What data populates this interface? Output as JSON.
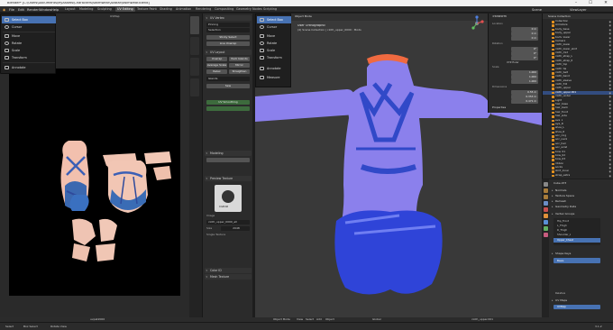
{
  "window": {
    "title": "Blender* [C:\\Users\\Documents\\MyAssets\\Characters\\swimwear\\Avatar\\swimwear.blend]"
  },
  "menubar": {
    "items": [
      "File",
      "Edit",
      "Render",
      "Window",
      "Help"
    ],
    "workspaces": [
      "Layout",
      "Modeling",
      "Sculpting",
      "UV Editing",
      "Texture Paint",
      "Shading",
      "Animation",
      "Rendering",
      "Compositing",
      "Geometry Nodes",
      "Scripting"
    ],
    "active_workspace": "UV Editing",
    "scene": "Scene",
    "view_layer": "ViewLayer"
  },
  "uv_tools": [
    {
      "label": "Select Box",
      "active": true
    },
    {
      "label": "Cursor",
      "active": false
    },
    {
      "label": "Move",
      "active": false
    },
    {
      "label": "Rotate",
      "active": false
    },
    {
      "label": "Scale",
      "active": false
    },
    {
      "label": "Transform",
      "active": false
    },
    {
      "label": "Annotate",
      "active": false
    }
  ],
  "viewport_tools": [
    {
      "label": "Select Box",
      "active": true
    },
    {
      "label": "Cursor",
      "active": false
    },
    {
      "label": "Move",
      "active": false
    },
    {
      "label": "Rotate",
      "active": false
    },
    {
      "label": "Scale",
      "active": false
    },
    {
      "label": "Transform",
      "active": false
    },
    {
      "label": "Annotate",
      "active": false
    },
    {
      "label": "Measure",
      "active": false
    }
  ],
  "uv_header": {
    "image_name": "uvpat2000",
    "uv_map": "UVMap"
  },
  "mid_panel": {
    "sections": [
      "UV Vertex",
      "UV Layout",
      "Modeling",
      "Preview Texture",
      "Color ID",
      "Mesh Texture"
    ],
    "buttons": [
      "Sticky Select",
      "Live Unwrap",
      "Unwrap",
      "Pack Islands",
      "Average Scale",
      "Mirror",
      "Relax",
      "Straighten",
      "Sew",
      "UV Smoothing"
    ],
    "fields": [
      "Pinning",
      "Selection",
      "Islands"
    ],
    "image_label": "CGEAR",
    "image_caption": "Image",
    "size_label": "Size",
    "size_value": "2048",
    "texture_name": "cloth_upper_0000_all",
    "single_texture": "Single Texture"
  },
  "viewport": {
    "view_name": "User Orthographic",
    "collection_path": "(4) Scene Collection | cloth_upper_0000 : Mods",
    "mode": "Object Mode",
    "menus": [
      "View",
      "Select",
      "Add",
      "Object"
    ],
    "shading": "Global",
    "pivot": "cloth_upper.001"
  },
  "npanel": {
    "transform_title": "Transform",
    "location_label": "Location",
    "location": [
      "0 m",
      "0 m",
      "0 m"
    ],
    "rotation_label": "Rotation",
    "rotation": [
      "0°",
      "0°",
      "0°"
    ],
    "mode_label": "XYZ Euler",
    "scale_label": "Scale",
    "scale": [
      "1.000",
      "1.000",
      "1.000"
    ],
    "dimensions_label": "Dimensions",
    "dimensions": [
      "0.55 m",
      "0.353 m",
      "0.471 m"
    ],
    "properties_title": "Properties"
  },
  "outliner": {
    "title": "Scene Collection",
    "rows": [
      {
        "name": "Collection",
        "selected": false
      },
      {
        "name": "Armature",
        "selected": false
      },
      {
        "name": "body_base",
        "selected": false
      },
      {
        "name": "body_upper",
        "selected": false
      },
      {
        "name": "body_lower",
        "selected": false
      },
      {
        "name": "Camera",
        "selected": false
      },
      {
        "name": "cloth_lower",
        "selected": false
      },
      {
        "name": "cloth_lower_skirt",
        "selected": false
      },
      {
        "name": "cloth_mid",
        "selected": false
      },
      {
        "name": "cloth_strap_L",
        "selected": false
      },
      {
        "name": "cloth_strap_R",
        "selected": false
      },
      {
        "name": "cloth_top",
        "selected": false
      },
      {
        "name": "cloth_tie",
        "selected": false
      },
      {
        "name": "cloth_belt",
        "selected": false
      },
      {
        "name": "cloth_band",
        "selected": false
      },
      {
        "name": "cloth_sleeve",
        "selected": false
      },
      {
        "name": "cloth_frill",
        "selected": false
      },
      {
        "name": "cloth_upper",
        "selected": false
      },
      {
        "name": "cloth_upper.001",
        "selected": true
      },
      {
        "name": "cloth_under",
        "selected": false
      },
      {
        "name": "Light",
        "selected": false
      },
      {
        "name": "hair_base",
        "selected": false
      },
      {
        "name": "hair_back",
        "selected": false
      },
      {
        "name": "hair_front",
        "selected": false
      },
      {
        "name": "hair_side",
        "selected": false
      },
      {
        "name": "eye_L",
        "selected": false
      },
      {
        "name": "eye_R",
        "selected": false
      },
      {
        "name": "shoe_L",
        "selected": false
      },
      {
        "name": "shoe_R",
        "selected": false
      },
      {
        "name": "acc_ring",
        "selected": false
      },
      {
        "name": "acc_neck",
        "selected": false
      },
      {
        "name": "acc_hair",
        "selected": false
      },
      {
        "name": "acc_wrist",
        "selected": false
      },
      {
        "name": "bow_01",
        "selected": false
      },
      {
        "name": "bow_02",
        "selected": false
      },
      {
        "name": "bow_03",
        "selected": false
      },
      {
        "name": "ribbon",
        "selected": false
      },
      {
        "name": "socks",
        "selected": false
      },
      {
        "name": "skirt_inner",
        "selected": false
      },
      {
        "name": "strap_extra",
        "selected": false
      }
    ]
  },
  "properties": {
    "object_name": "Cube.073",
    "sections": [
      "Normals",
      "Texture Space",
      "Remesh",
      "Geometry Data",
      "Shape Keys",
      "UV Maps",
      "Vertex Groups",
      "Face Maps",
      "Attributes",
      "Custom Properties"
    ],
    "vertex_groups": [
      "Hip_Front",
      "L_Thigh",
      "R_Thigh",
      "Shoulder_L",
      "Upper_Chest"
    ],
    "shape_key": "Basis",
    "uv_map": "UVMap",
    "relative_label": "Relative"
  },
  "statusbar": {
    "left": [
      "Select",
      "Box Select",
      "Rotate View"
    ],
    "right": "3.1.2"
  },
  "colors": {
    "accent": "#4772b3",
    "mesh_purple": "#8b80ec",
    "mesh_blue": "#2f44d8",
    "strap_blue": "#3149c8",
    "neck_orange": "#f06a40"
  }
}
